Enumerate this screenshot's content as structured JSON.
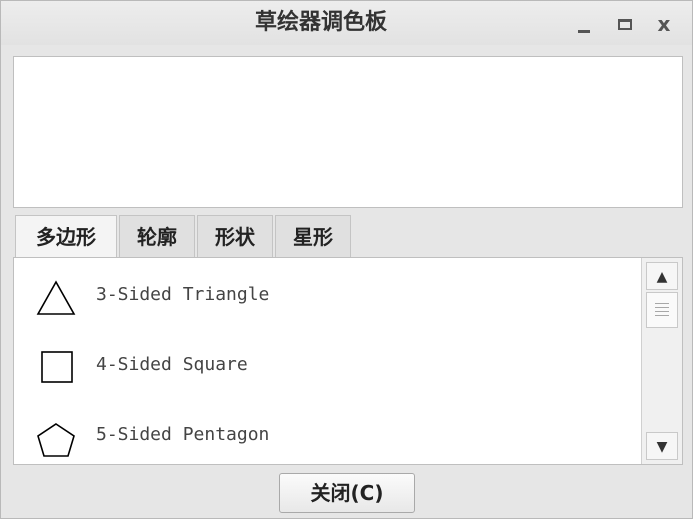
{
  "window": {
    "title": "草绘器调色板",
    "controls": [
      "minimize-icon",
      "maximize-icon",
      "close-icon"
    ],
    "close_glyph": "x"
  },
  "tabs": [
    {
      "label": "多边形",
      "active": true
    },
    {
      "label": "轮廓",
      "active": false
    },
    {
      "label": "形状",
      "active": false
    },
    {
      "label": "星形",
      "active": false
    }
  ],
  "list": {
    "items": [
      {
        "label": "3-Sided Triangle",
        "icon": "triangle-icon"
      },
      {
        "label": "4-Sided Square",
        "icon": "square-icon"
      },
      {
        "label": "5-Sided Pentagon",
        "icon": "pentagon-icon"
      }
    ],
    "scroll_up_glyph": "▲",
    "scroll_down_glyph": "▼"
  },
  "footer": {
    "close_label": "关闭(C)"
  }
}
